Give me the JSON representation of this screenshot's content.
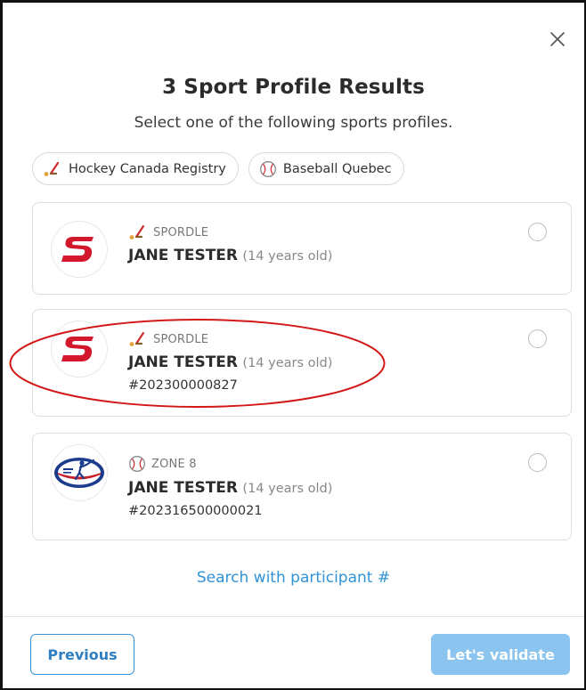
{
  "modal": {
    "title": "3 Sport Profile Results",
    "subtitle": "Select one of the following sports profiles."
  },
  "filters": [
    {
      "label": "Hockey Canada Registry",
      "icon": "hockey-stick-icon"
    },
    {
      "label": "Baseball Quebec",
      "icon": "baseball-icon"
    }
  ],
  "profiles": [
    {
      "org": "SPORDLE",
      "org_icon": "hockey-stick-icon",
      "name": "JANE TESTER",
      "age": "(14 years old)",
      "participant_number": "",
      "logo": "spordle-logo"
    },
    {
      "org": "SPORDLE",
      "org_icon": "hockey-stick-icon",
      "name": "JANE TESTER",
      "age": "(14 years old)",
      "participant_number": "#202300000827",
      "logo": "spordle-logo"
    },
    {
      "org": "ZONE 8",
      "org_icon": "baseball-icon",
      "name": "JANE TESTER",
      "age": "(14 years old)",
      "participant_number": "#202316500000021",
      "logo": "baseball-zone-logo"
    }
  ],
  "search_link": "Search with participant #",
  "footer": {
    "previous_label": "Previous",
    "validate_label": "Let's validate"
  },
  "colors": {
    "accent": "#2f93d6",
    "validate_bg": "#8ac4ef",
    "highlight": "#d31717",
    "spordle_red": "#d3172c"
  }
}
